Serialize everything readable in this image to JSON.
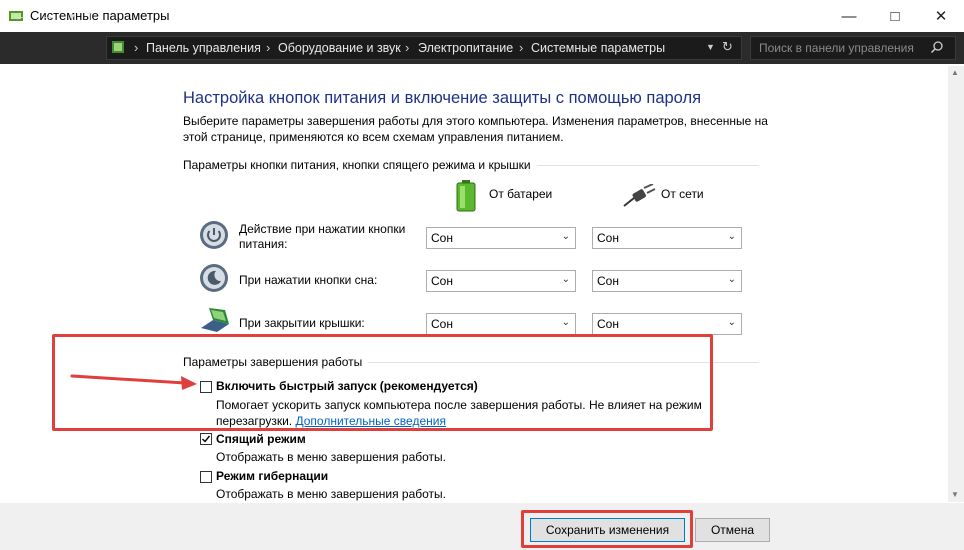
{
  "window": {
    "title": "Системные параметры"
  },
  "nav": {
    "breadcrumbs": [
      "Панель управления",
      "Оборудование и звук",
      "Электропитание",
      "Системные параметры"
    ],
    "search_placeholder": "Поиск в панели управления"
  },
  "page": {
    "heading": "Настройка кнопок питания и включение защиты с помощью пароля",
    "description": "Выберите параметры завершения работы для этого компьютера. Изменения параметров, внесенные на этой странице, применяются ко всем схемам управления питанием.",
    "power_group_title": "Параметры кнопки питания, кнопки спящего режима и крышки",
    "col_battery": "От батареи",
    "col_ac": "От сети",
    "rows": [
      {
        "label": "Действие при нажатии кнопки питания:",
        "battery": "Сон",
        "ac": "Сон"
      },
      {
        "label": "При нажатии кнопки сна:",
        "battery": "Сон",
        "ac": "Сон"
      },
      {
        "label": "При закрытии крышки:",
        "battery": "Сон",
        "ac": "Сон"
      }
    ],
    "shutdown_group_title": "Параметры завершения работы",
    "fast_startup": {
      "label": "Включить быстрый запуск (рекомендуется)",
      "desc": "Помогает ускорить запуск компьютера после завершения работы. Не влияет на режим перезагрузки.",
      "link": "Дополнительные сведения",
      "checked": false
    },
    "sleep": {
      "label": "Спящий режим",
      "desc": "Отображать в меню завершения работы.",
      "checked": true
    },
    "hibernate": {
      "label": "Режим гибернации",
      "desc": "Отображать в меню завершения работы.",
      "checked": false
    }
  },
  "footer": {
    "save_label": "Сохранить изменения",
    "cancel_label": "Отмена"
  },
  "colors": {
    "heading": "#1e3287",
    "link": "#0063c6",
    "highlight": "#e0403c",
    "navbar": "#2b2b2b"
  }
}
